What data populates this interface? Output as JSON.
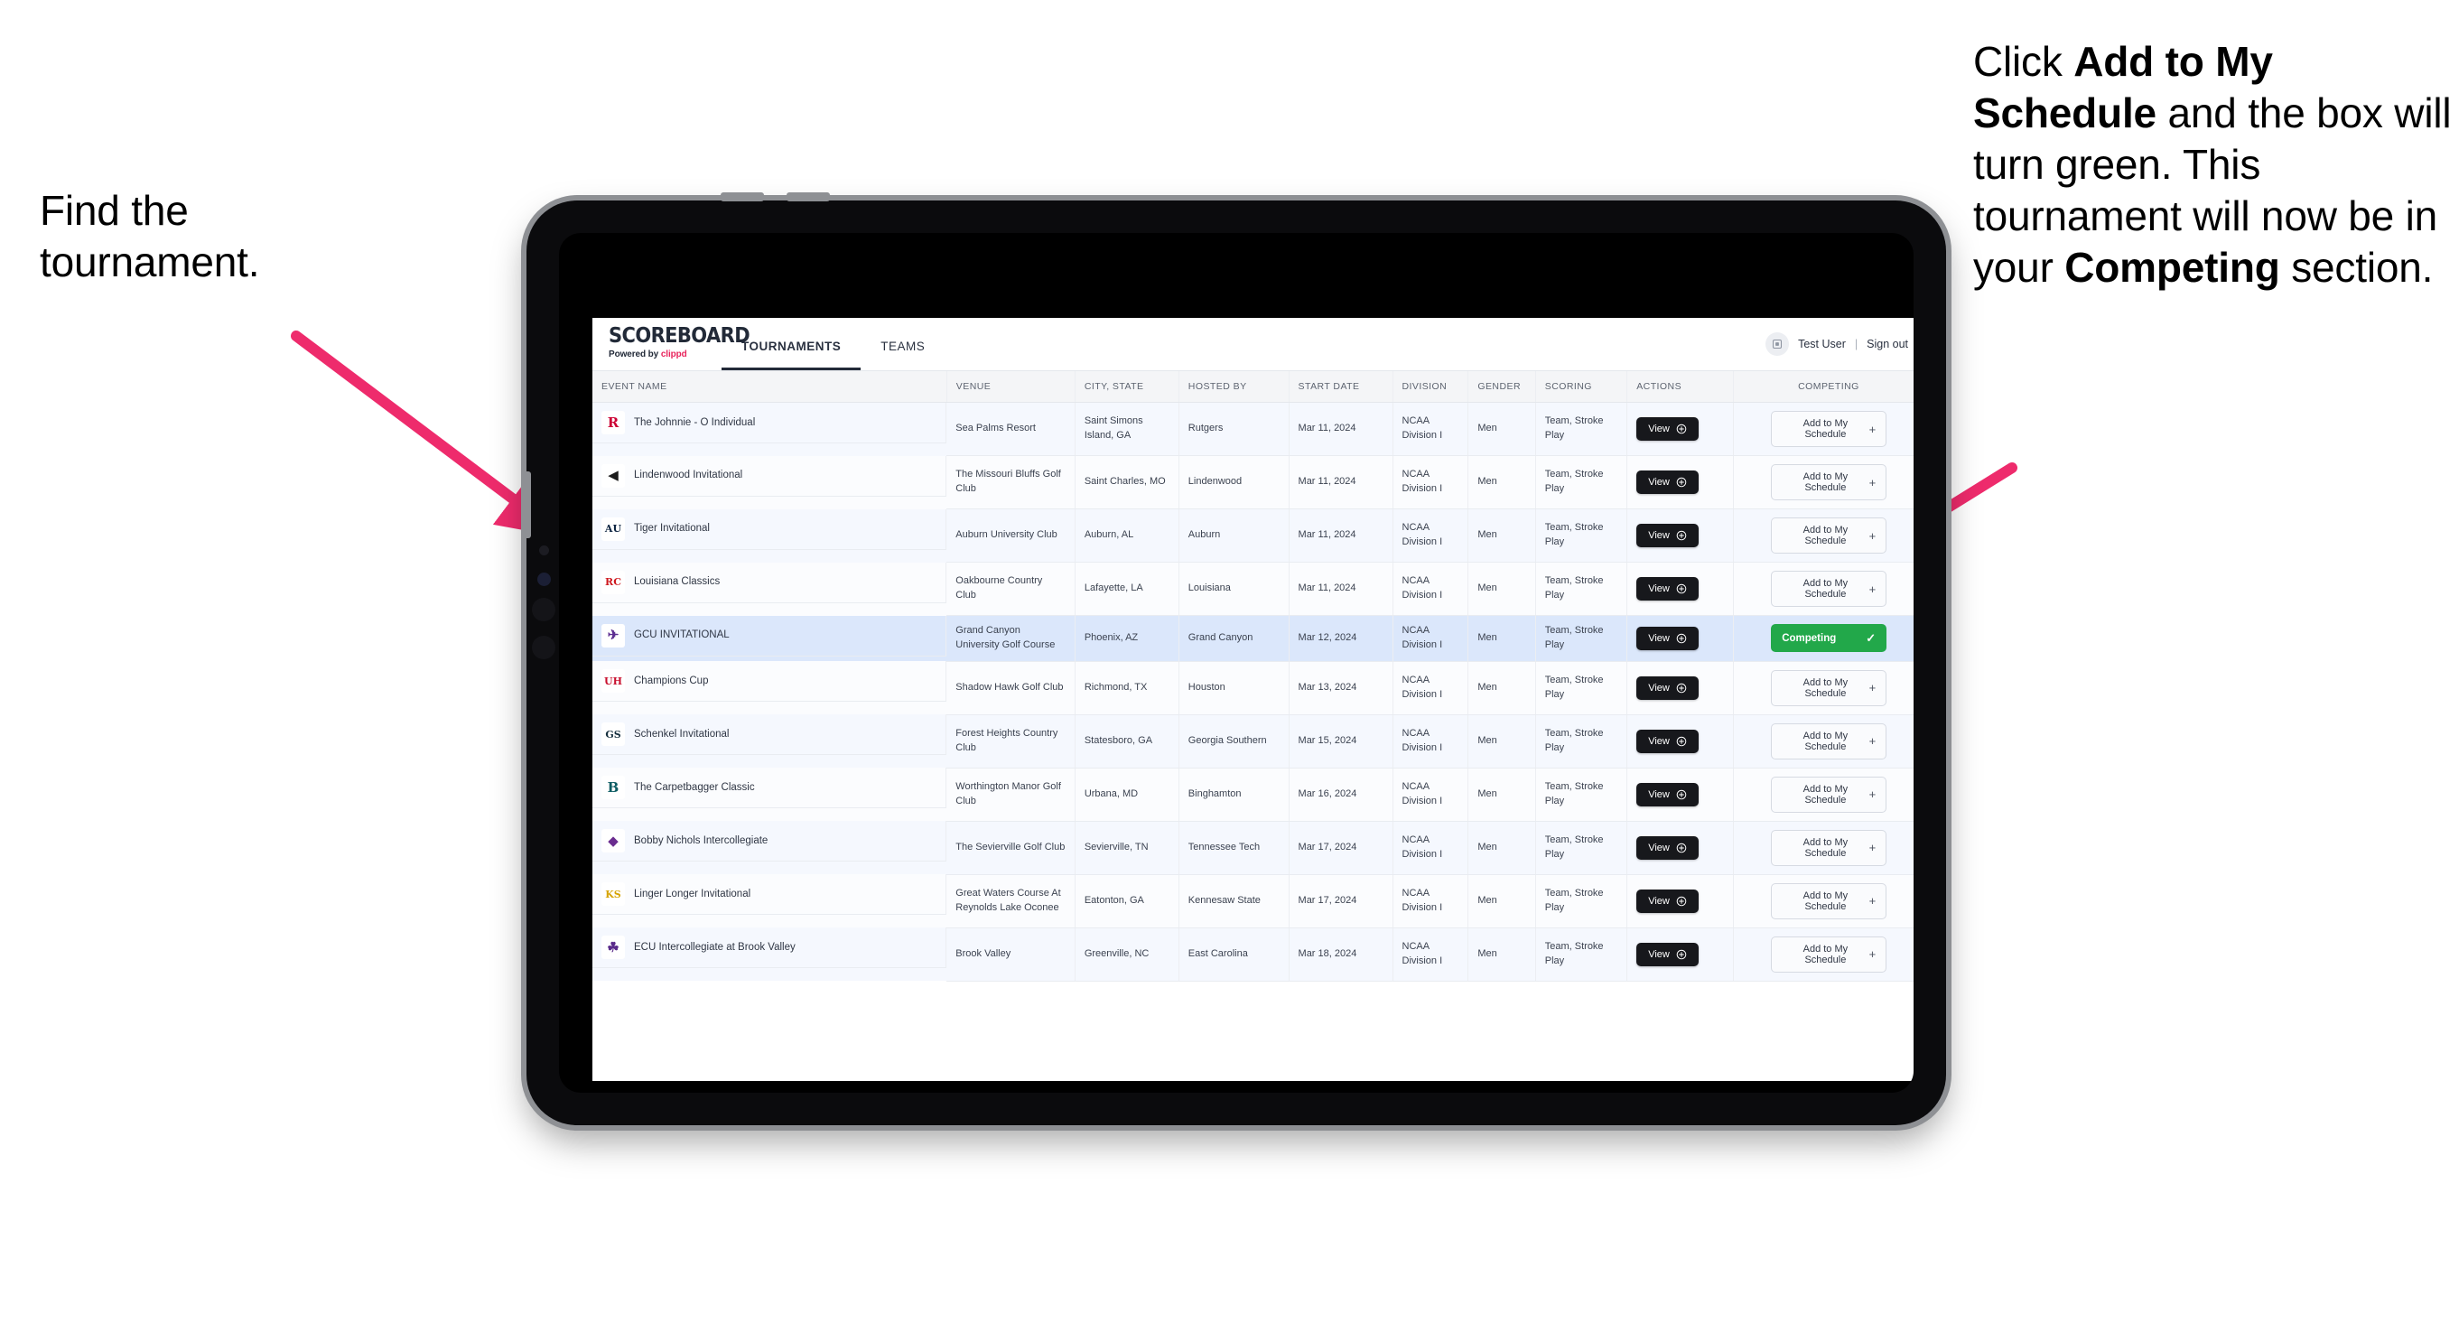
{
  "annotations": {
    "left": {
      "name": "find-the-tournament-callout",
      "lines": [
        "Find the",
        "tournament."
      ]
    },
    "right": {
      "name": "add-to-my-schedule-callout",
      "segments": [
        {
          "text": "Click ",
          "bold": false
        },
        {
          "text": "Add to My Schedule",
          "bold": true
        },
        {
          "text": " and the box will turn green. This tournament will now be in your ",
          "bold": false
        },
        {
          "text": "Competing",
          "bold": true
        },
        {
          "text": " section.",
          "bold": false
        }
      ],
      "plain": "Click Add to My Schedule and the box will turn green. This tournament will now be in your Competing section."
    },
    "arrow_color": "#ee2b6c"
  },
  "app": {
    "brand": {
      "title": "SCOREBOARD",
      "powered_prefix": "Powered by ",
      "powered_brand": "clippd"
    },
    "nav": [
      {
        "label": "TOURNAMENTS",
        "active": true
      },
      {
        "label": "TEAMS",
        "active": false
      }
    ],
    "header_right": {
      "avatar_icon": "user-avatar-icon",
      "user": "Test User",
      "separator": "|",
      "sign_out": "Sign out"
    },
    "columns": [
      "EVENT NAME",
      "VENUE",
      "CITY, STATE",
      "HOSTED BY",
      "START DATE",
      "DIVISION",
      "GENDER",
      "SCORING",
      "ACTIONS",
      "COMPETING"
    ],
    "buttons": {
      "view": "View",
      "view_icon": "plus-circle-icon",
      "add": "Add to My Schedule",
      "add_icon": "plus-icon",
      "competing": "Competing",
      "competing_icon": "check-icon"
    },
    "colors": {
      "accent_pink": "#e8245c",
      "competing_green": "#22a84a",
      "selected_row": "#dbe7fb",
      "header_dark": "#222a38",
      "scrollbar": "#2f57d0"
    },
    "rows": [
      {
        "event": "The Johnnie - O Individual",
        "venue": "Sea Palms Resort",
        "city": "Saint Simons Island, GA",
        "hosted_by": "Rutgers",
        "start_date": "Mar 11, 2024",
        "division": "NCAA Division I",
        "gender": "Men",
        "scoring": "Team, Stroke Play",
        "competing": false,
        "logo": {
          "glyph": "R",
          "fg": "#cc0033",
          "bg": "#ffffff",
          "name": "rutgers-logo"
        }
      },
      {
        "event": "Lindenwood Invitational",
        "venue": "The Missouri Bluffs Golf Club",
        "city": "Saint Charles, MO",
        "hosted_by": "Lindenwood",
        "start_date": "Mar 11, 2024",
        "division": "NCAA Division I",
        "gender": "Men",
        "scoring": "Team, Stroke Play",
        "competing": false,
        "logo": {
          "glyph": "◀",
          "fg": "#1b1b1b",
          "bg": "#ffffff",
          "name": "lindenwood-logo"
        }
      },
      {
        "event": "Tiger Invitational",
        "venue": "Auburn University Club",
        "city": "Auburn, AL",
        "hosted_by": "Auburn",
        "start_date": "Mar 11, 2024",
        "division": "NCAA Division I",
        "gender": "Men",
        "scoring": "Team, Stroke Play",
        "competing": false,
        "logo": {
          "glyph": "AU",
          "fg": "#0c2340",
          "bg": "#ffffff",
          "name": "auburn-logo"
        }
      },
      {
        "event": "Louisiana Classics",
        "venue": "Oakbourne Country Club",
        "city": "Lafayette, LA",
        "hosted_by": "Louisiana",
        "start_date": "Mar 11, 2024",
        "division": "NCAA Division I",
        "gender": "Men",
        "scoring": "Team, Stroke Play",
        "competing": false,
        "logo": {
          "glyph": "RC",
          "fg": "#ce181e",
          "bg": "#ffffff",
          "name": "louisiana-ragin-cajuns-logo"
        }
      },
      {
        "event": "GCU INVITATIONAL",
        "venue": "Grand Canyon University Golf Course",
        "city": "Phoenix, AZ",
        "hosted_by": "Grand Canyon",
        "start_date": "Mar 12, 2024",
        "division": "NCAA Division I",
        "gender": "Men",
        "scoring": "Team, Stroke Play",
        "competing": true,
        "selected": true,
        "logo": {
          "glyph": "✈",
          "fg": "#5c2d91",
          "bg": "#ffffff",
          "name": "grand-canyon-lopes-logo"
        }
      },
      {
        "event": "Champions Cup",
        "venue": "Shadow Hawk Golf Club",
        "city": "Richmond, TX",
        "hosted_by": "Houston",
        "start_date": "Mar 13, 2024",
        "division": "NCAA Division I",
        "gender": "Men",
        "scoring": "Team, Stroke Play",
        "competing": false,
        "logo": {
          "glyph": "UH",
          "fg": "#c8102e",
          "bg": "#ffffff",
          "name": "houston-logo"
        }
      },
      {
        "event": "Schenkel Invitational",
        "venue": "Forest Heights Country Club",
        "city": "Statesboro, GA",
        "hosted_by": "Georgia Southern",
        "start_date": "Mar 15, 2024",
        "division": "NCAA Division I",
        "gender": "Men",
        "scoring": "Team, Stroke Play",
        "competing": false,
        "logo": {
          "glyph": "GS",
          "fg": "#16303f",
          "bg": "#ffffff",
          "name": "georgia-southern-logo"
        }
      },
      {
        "event": "The Carpetbagger Classic",
        "venue": "Worthington Manor Golf Club",
        "city": "Urbana, MD",
        "hosted_by": "Binghamton",
        "start_date": "Mar 16, 2024",
        "division": "NCAA Division I",
        "gender": "Men",
        "scoring": "Team, Stroke Play",
        "competing": false,
        "logo": {
          "glyph": "B",
          "fg": "#0d5c63",
          "bg": "#ffffff",
          "name": "binghamton-logo"
        }
      },
      {
        "event": "Bobby Nichols Intercollegiate",
        "venue": "The Sevierville Golf Club",
        "city": "Sevierville, TN",
        "hosted_by": "Tennessee Tech",
        "start_date": "Mar 17, 2024",
        "division": "NCAA Division I",
        "gender": "Men",
        "scoring": "Team, Stroke Play",
        "competing": false,
        "logo": {
          "glyph": "◆",
          "fg": "#6a2c8f",
          "bg": "#ffffff",
          "name": "tennessee-tech-golden-eagles-logo"
        }
      },
      {
        "event": "Linger Longer Invitational",
        "venue": "Great Waters Course At Reynolds Lake Oconee",
        "city": "Eatonton, GA",
        "hosted_by": "Kennesaw State",
        "start_date": "Mar 17, 2024",
        "division": "NCAA Division I",
        "gender": "Men",
        "scoring": "Team, Stroke Play",
        "competing": false,
        "logo": {
          "glyph": "KS",
          "fg": "#d6a300",
          "bg": "#ffffff",
          "name": "kennesaw-state-logo"
        }
      },
      {
        "event": "ECU Intercollegiate at Brook Valley",
        "venue": "Brook Valley",
        "city": "Greenville, NC",
        "hosted_by": "East Carolina",
        "start_date": "Mar 18, 2024",
        "division": "NCAA Division I",
        "gender": "Men",
        "scoring": "Team, Stroke Play",
        "competing": false,
        "partial": true,
        "logo": {
          "glyph": "☘",
          "fg": "#592a8a",
          "bg": "#ffffff",
          "name": "east-carolina-logo"
        }
      }
    ]
  }
}
